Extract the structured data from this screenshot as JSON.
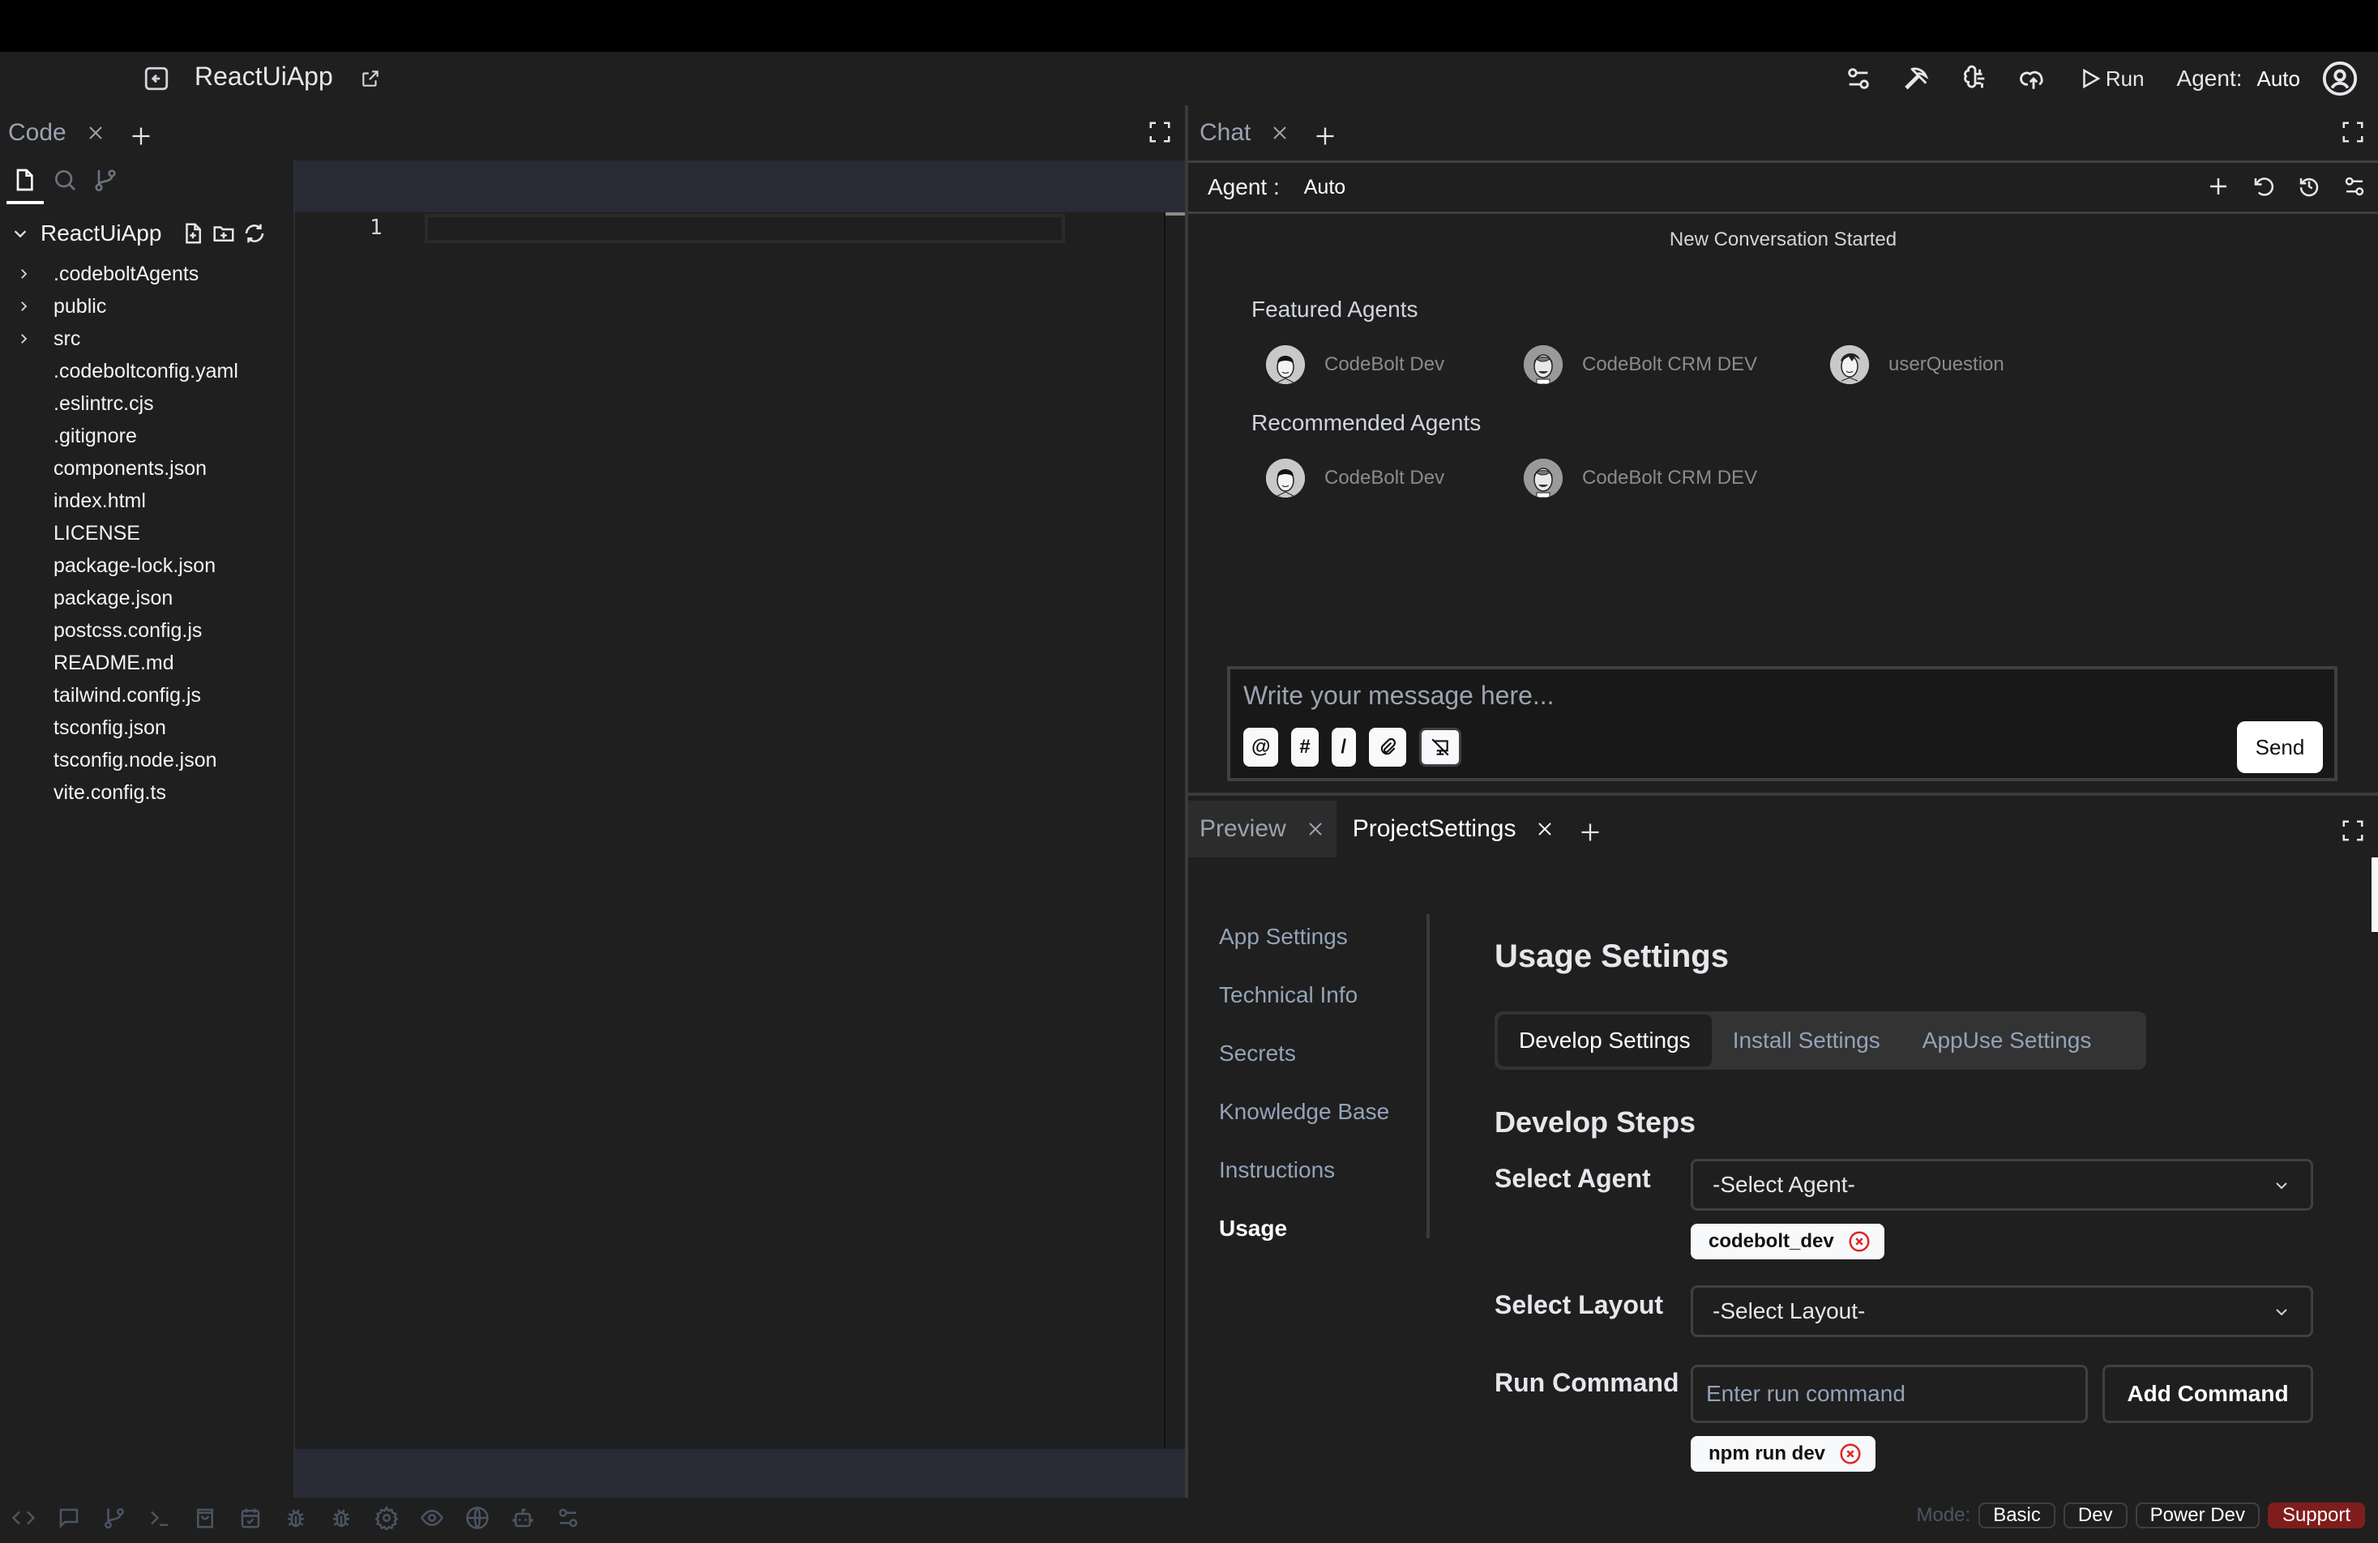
{
  "app": {
    "title": "ReactUiApp",
    "toolbar": {
      "run_label": "Run",
      "agent_label": "Agent:",
      "agent_value": "Auto",
      "icons": [
        "sliders-icon",
        "pickaxe-icon",
        "brain-icon",
        "cloud-upload-icon",
        "play-icon",
        "user-avatar-icon"
      ]
    }
  },
  "code_panel": {
    "tab_label": "Code",
    "sidebar_tabs": [
      "files-icon",
      "search-icon",
      "git-branch-icon"
    ],
    "root_folder": "ReactUiApp",
    "root_actions": [
      "new-file-icon",
      "new-folder-icon",
      "refresh-icon"
    ],
    "tree": [
      {
        "name": ".codeboltAgents",
        "folder": true
      },
      {
        "name": "public",
        "folder": true
      },
      {
        "name": "src",
        "folder": true
      },
      {
        "name": ".codeboltconfig.yaml",
        "folder": false
      },
      {
        "name": ".eslintrc.cjs",
        "folder": false
      },
      {
        "name": ".gitignore",
        "folder": false
      },
      {
        "name": "components.json",
        "folder": false
      },
      {
        "name": "index.html",
        "folder": false
      },
      {
        "name": "LICENSE",
        "folder": false
      },
      {
        "name": "package-lock.json",
        "folder": false
      },
      {
        "name": "package.json",
        "folder": false
      },
      {
        "name": "postcss.config.js",
        "folder": false
      },
      {
        "name": "README.md",
        "folder": false
      },
      {
        "name": "tailwind.config.js",
        "folder": false
      },
      {
        "name": "tsconfig.json",
        "folder": false
      },
      {
        "name": "tsconfig.node.json",
        "folder": false
      },
      {
        "name": "vite.config.ts",
        "folder": false
      }
    ],
    "editor": {
      "line_number": "1"
    }
  },
  "chat_panel": {
    "tab_label": "Chat",
    "agent_label": "Agent :",
    "agent_value": "Auto",
    "conversation_status": "New Conversation Started",
    "featured_title": "Featured Agents",
    "featured": [
      {
        "name": "CodeBolt Dev"
      },
      {
        "name": "CodeBolt CRM DEV"
      },
      {
        "name": "userQuestion"
      }
    ],
    "recommended_title": "Recommended Agents",
    "recommended": [
      {
        "name": "CodeBolt Dev"
      },
      {
        "name": "CodeBolt CRM DEV"
      }
    ],
    "input_placeholder": "Write your message here...",
    "tools": [
      "@",
      "#",
      "/"
    ],
    "send_label": "Send"
  },
  "bottom_panel": {
    "tabs": [
      {
        "label": "Preview",
        "active": false
      },
      {
        "label": "ProjectSettings",
        "active": true
      }
    ],
    "nav": [
      {
        "label": "App Settings",
        "active": false
      },
      {
        "label": "Technical Info",
        "active": false
      },
      {
        "label": "Secrets",
        "active": false
      },
      {
        "label": "Knowledge Base",
        "active": false
      },
      {
        "label": "Instructions",
        "active": false
      },
      {
        "label": "Usage",
        "active": true
      }
    ],
    "usage_title": "Usage Settings",
    "segments": [
      {
        "label": "Develop Settings",
        "active": true
      },
      {
        "label": "Install Settings",
        "active": false
      },
      {
        "label": "AppUse Settings",
        "active": false
      }
    ],
    "steps_title": "Develop Steps",
    "select_agent_label": "Select Agent",
    "select_agent_value": "-Select Agent-",
    "agent_chip": "codebolt_dev",
    "select_layout_label": "Select Layout",
    "select_layout_value": "-Select Layout-",
    "run_command_label": "Run Command",
    "run_command_placeholder": "Enter run command",
    "add_command_label": "Add Command",
    "command_chip": "npm run dev"
  },
  "status_bar": {
    "icons": [
      "code-icon",
      "chat-icon",
      "git-branch-icon",
      "terminal-icon",
      "shopping-bag-icon",
      "calendar-check-icon",
      "bug-icon",
      "bug-alt-icon",
      "settings-icon",
      "eye-icon",
      "globe-icon",
      "bot-icon",
      "sliders-icon"
    ],
    "mode_label": "Mode:",
    "modes": [
      "Basic",
      "Dev",
      "Power Dev"
    ],
    "support_label": "Support",
    "support_color": "#7f1d1d"
  }
}
